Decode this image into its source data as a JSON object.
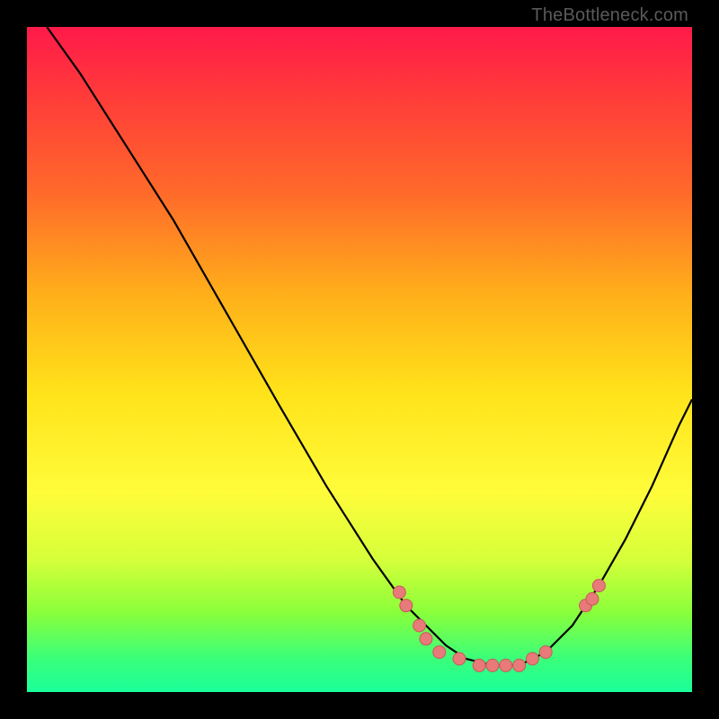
{
  "attribution": "TheBottleneck.com",
  "colors": {
    "page_bg": "#000000",
    "gradient_top": "#ff1a4a",
    "gradient_bottom": "#1aff9a",
    "curve": "#000000",
    "marker_fill": "#e87a7a",
    "marker_stroke": "#c85a5a"
  },
  "chart_data": {
    "type": "line",
    "title": "",
    "xlabel": "",
    "ylabel": "",
    "xlim": [
      0,
      100
    ],
    "ylim": [
      0,
      100
    ],
    "series": [
      {
        "name": "curve",
        "x": [
          3,
          8,
          15,
          22,
          30,
          38,
          45,
          52,
          57,
          60,
          63,
          66,
          70,
          74,
          78,
          82,
          86,
          90,
          94,
          98,
          100
        ],
        "y": [
          100,
          93,
          82,
          71,
          57,
          43,
          31,
          20,
          13,
          10,
          7,
          5,
          4,
          4,
          6,
          10,
          16,
          23,
          31,
          40,
          44
        ]
      }
    ],
    "markers": [
      {
        "x": 56,
        "y": 15
      },
      {
        "x": 57,
        "y": 13
      },
      {
        "x": 59,
        "y": 10
      },
      {
        "x": 60,
        "y": 8
      },
      {
        "x": 62,
        "y": 6
      },
      {
        "x": 65,
        "y": 5
      },
      {
        "x": 68,
        "y": 4
      },
      {
        "x": 70,
        "y": 4
      },
      {
        "x": 72,
        "y": 4
      },
      {
        "x": 74,
        "y": 4
      },
      {
        "x": 76,
        "y": 5
      },
      {
        "x": 78,
        "y": 6
      },
      {
        "x": 84,
        "y": 13
      },
      {
        "x": 85,
        "y": 14
      },
      {
        "x": 86,
        "y": 16
      }
    ]
  }
}
